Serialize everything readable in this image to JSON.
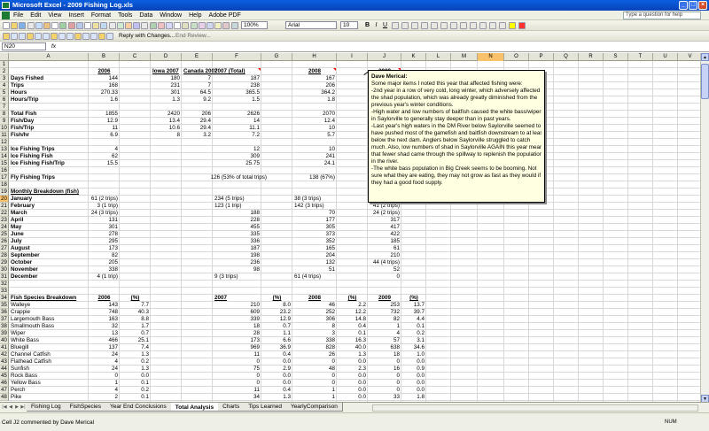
{
  "window": {
    "title": "Microsoft Excel - 2009 Fishing Log.xls"
  },
  "menu": [
    "File",
    "Edit",
    "View",
    "Insert",
    "Format",
    "Tools",
    "Data",
    "Window",
    "Help",
    "Adobe PDF"
  ],
  "help_placeholder": "Type a question for help",
  "toolbar": {
    "zoom": "100%",
    "font": "Arial",
    "size": "10",
    "bold": "B",
    "italic": "I",
    "underline": "U",
    "reply": "Reply with Changes...",
    "end_review": "End Review..."
  },
  "namebox": "N20",
  "formula_fx": "fx",
  "columns": [
    "A",
    "B",
    "C",
    "D",
    "E",
    "F",
    "G",
    "H",
    "I",
    "J",
    "K",
    "L",
    "M",
    "N",
    "O",
    "P",
    "Q",
    "R",
    "S",
    "T",
    "U",
    "V",
    "W"
  ],
  "selected": {
    "col": "N",
    "row": "20"
  },
  "rows": [
    "1",
    "2",
    "3",
    "4",
    "5",
    "6",
    "7",
    "8",
    "9",
    "10",
    "11",
    "12",
    "13",
    "14",
    "15",
    "16",
    "17",
    "18",
    "19",
    "20",
    "21",
    "22",
    "23",
    "24",
    "25",
    "26",
    "27",
    "28",
    "29",
    "30",
    "31",
    "32",
    "33",
    "34",
    "35",
    "36",
    "37",
    "38",
    "39",
    "40",
    "41",
    "42",
    "43",
    "44",
    "45",
    "46",
    "47",
    "48"
  ],
  "labels": {
    "r3": "Days Fished",
    "r4": "Trips",
    "r5": "Hours",
    "r6": "Hours/Trip",
    "r8": "Total Fish",
    "r9": "Fish/Day",
    "r10": "Fish/Trip",
    "r11": "Fish/hr",
    "r13": "Ice Fishing Trips",
    "r14": "Ice Fishing Fish",
    "r15": "Ice Fishing Fish/Trip",
    "r17": "Fly Fishing Trips",
    "r19": "Monthly Breakdown (fish)",
    "r20": "January",
    "r21": "February",
    "r22": "March",
    "r23": "April",
    "r24": "May",
    "r25": "June",
    "r26": "July",
    "r27": "August",
    "r28": "September",
    "r29": "October",
    "r30": "November",
    "r31": "December",
    "r34": "Fish Species Breakdown",
    "r35": "Walleye",
    "r36": "Crappie",
    "r37": "Largemouth Bass",
    "r38": "Smallmouth Bass",
    "r39": "Wiper",
    "r40": "White Bass",
    "r41": "Bluegill",
    "r42": "Channel Catfish",
    "r43": "Flathead Catfish",
    "r44": "Sunfish",
    "r45": "Rock Bass",
    "r46": "Yellow Bass",
    "r47": "Perch",
    "r48": "Pike"
  },
  "headers": {
    "B2": "2006",
    "D2": "Iowa 2007",
    "E2": "Canada 2007",
    "F2": "2007 (Total)",
    "H2": "2008",
    "J2": "2009",
    "B34": "2006",
    "C34": "(%)",
    "F34": "2007",
    "G34": "(%)",
    "H34": "2008",
    "I34": "(%)",
    "J34": "2009",
    "K34": "(%)"
  },
  "colB": {
    "r3": "144",
    "r4": "168",
    "r5": "270.33",
    "r6": "1.6",
    "r8": "1855",
    "r9": "12.9",
    "r10": "11",
    "r11": "6.9",
    "r13": "4",
    "r14": "62",
    "r15": "15.5",
    "r20": "61 (2 trips)",
    "r21": "3 (1 trip)",
    "r22": "24 (3 trips)",
    "r23": "131",
    "r24": "301",
    "r25": "278",
    "r26": "295",
    "r27": "173",
    "r28": "82",
    "r29": "205",
    "r30": "338",
    "r31": "4 (1 trip)"
  },
  "colD": {
    "r3": "180",
    "r4": "231",
    "r5": "301",
    "r6": "1.3",
    "r8": "2420",
    "r9": "13.4",
    "r10": "10.6",
    "r11": "8"
  },
  "colE": {
    "r3": "7",
    "r4": "7",
    "r5": "64.5",
    "r6": "9.2",
    "r8": "206",
    "r9": "29.4",
    "r10": "29.4",
    "r11": "3.2"
  },
  "colF": {
    "r3": "187",
    "r4": "238",
    "r5": "365.5",
    "r6": "1.5",
    "r8": "2626",
    "r9": "14",
    "r10": "11.1",
    "r11": "7.2",
    "r13": "12",
    "r14": "309",
    "r15": "25.75",
    "r17": "126 (53% of total trips)",
    "r20": "234 (5 trips)",
    "r21": "123 (1 trip)",
    "r22": "188",
    "r23": "228",
    "r24": "455",
    "r25": "335",
    "r26": "336",
    "r27": "187",
    "r28": "198",
    "r29": "236",
    "r30": "98",
    "r31": "9 (3 trips)"
  },
  "colH": {
    "r3": "167",
    "r4": "206",
    "r5": "364.2",
    "r6": "1.8",
    "r8": "2070",
    "r9": "12.4",
    "r10": "10",
    "r11": "5.7",
    "r13": "10",
    "r14": "241",
    "r15": "24.1",
    "r17": "138 (67%)",
    "r20": "38 (3 trips)",
    "r21": "142 (3 trips)",
    "r22": "70",
    "r23": "177",
    "r24": "305",
    "r25": "373",
    "r26": "352",
    "r27": "165",
    "r28": "204",
    "r29": "132",
    "r30": "51",
    "r31": "61 (4 trips)"
  },
  "colJ": {
    "r3": "104",
    "r4": "134",
    "r5": "251",
    "r6": "1.9",
    "r8": "1846",
    "r9": "17.8",
    "r10": "13.8",
    "r11": "7.4",
    "r13": "8",
    "r14": "114",
    "r15": "14.3",
    "r17": "101 (75%)",
    "r20": "73",
    "r21": "41 (2 trips)",
    "r22": "24 (2 trips)",
    "r23": "317",
    "r24": "417",
    "r25": "422",
    "r26": "185",
    "r27": "61",
    "r28": "210",
    "r29": "44 (4 trips)",
    "r30": "52",
    "r31": "0"
  },
  "species": [
    {
      "b": "143",
      "c": "7.7",
      "f": "210",
      "g": "8.0",
      "h": "46",
      "i": "2.2",
      "j": "253",
      "k": "13.7"
    },
    {
      "b": "748",
      "c": "40.3",
      "f": "609",
      "g": "23.2",
      "h": "252",
      "i": "12.2",
      "j": "732",
      "k": "39.7"
    },
    {
      "b": "163",
      "c": "8.8",
      "f": "339",
      "g": "12.9",
      "h": "306",
      "i": "14.8",
      "j": "82",
      "k": "4.4"
    },
    {
      "b": "32",
      "c": "1.7",
      "f": "18",
      "g": "0.7",
      "h": "8",
      "i": "0.4",
      "j": "1",
      "k": "0.1"
    },
    {
      "b": "13",
      "c": "0.7",
      "f": "28",
      "g": "1.1",
      "h": "3",
      "i": "0.1",
      "j": "4",
      "k": "0.2"
    },
    {
      "b": "466",
      "c": "25.1",
      "f": "173",
      "g": "6.6",
      "h": "338",
      "i": "16.3",
      "j": "57",
      "k": "3.1"
    },
    {
      "b": "137",
      "c": "7.4",
      "f": "969",
      "g": "36.9",
      "h": "828",
      "i": "40.0",
      "j": "638",
      "k": "34.6"
    },
    {
      "b": "24",
      "c": "1.3",
      "f": "11",
      "g": "0.4",
      "h": "26",
      "i": "1.3",
      "j": "18",
      "k": "1.0"
    },
    {
      "b": "4",
      "c": "0.2",
      "f": "0",
      "g": "0.0",
      "h": "0",
      "i": "0.0",
      "j": "0",
      "k": "0.0"
    },
    {
      "b": "24",
      "c": "1.3",
      "f": "75",
      "g": "2.9",
      "h": "48",
      "i": "2.3",
      "j": "16",
      "k": "0.9"
    },
    {
      "b": "0",
      "c": "0.0",
      "f": "0",
      "g": "0.0",
      "h": "0",
      "i": "0.0",
      "j": "0",
      "k": "0.0"
    },
    {
      "b": "1",
      "c": "0.1",
      "f": "0",
      "g": "0.0",
      "h": "0",
      "i": "0.0",
      "j": "0",
      "k": "0.0"
    },
    {
      "b": "4",
      "c": "0.2",
      "f": "11",
      "g": "0.4",
      "h": "1",
      "i": "0.0",
      "j": "0",
      "k": "0.0"
    },
    {
      "b": "2",
      "c": "0.1",
      "f": "34",
      "g": "1.3",
      "h": "1",
      "i": "0.0",
      "j": "33",
      "k": "1.8"
    }
  ],
  "comment": {
    "author": "Dave Merical:",
    "lines": [
      "Some major items I noted this year that affected fishing were:",
      "-2nd year in a row of very cold, long winter, which adversely affected",
      "the shad population, which was already greatly diminished from the",
      "previous year's winter conditions.",
      "-High water and low numbers of baitfish caused the white bass/wipers",
      "in Saylorville to generally stay deeper than in past years.",
      "-Last year's high waters in the DM River below Saylorville seemed to",
      "have pushed most of the gamefish and baitfish downstream to at least",
      "below the next dam.  Anglers below Saylorville struggled to catch",
      "much.  Also, low numbers of shad in Saylorville AGAIN this year meant",
      "that fewer shad came through the spillway to replenish the population",
      "in the river.",
      "-The white bass population in Big Creek seems to be booming.  Not",
      "sure what they are eating, they may not grow as fast as they would if",
      "they had a good food supply."
    ]
  },
  "tabs": [
    "Fishing Log",
    "FishSpecies",
    "Year End Conclusions",
    "Total Analysis",
    "Charts",
    "Tips Learned",
    "YearlyComparison"
  ],
  "active_tab": "Total Analysis",
  "status": {
    "left": "Cell J2 commented by Dave Merical",
    "num": "NUM"
  }
}
